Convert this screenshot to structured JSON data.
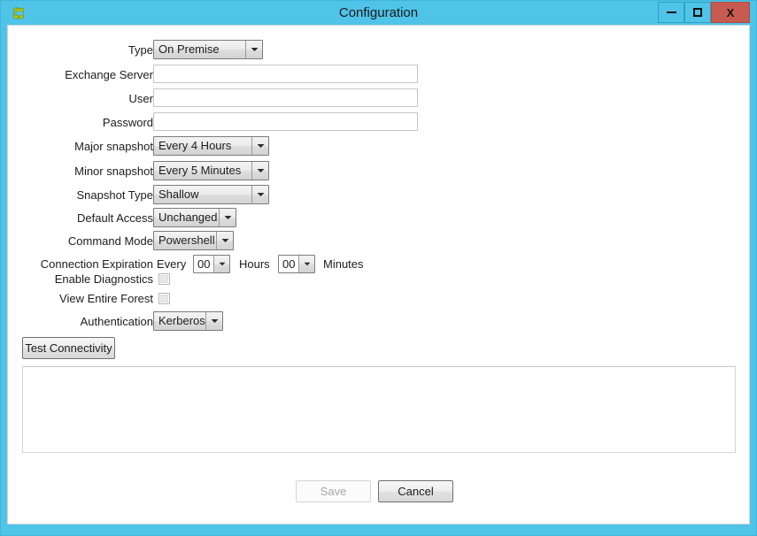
{
  "window": {
    "title": "Configuration",
    "app_icon": "puzzle-piece-icon",
    "accent_color": "#4fc3e8",
    "close_color": "#c75b51",
    "controls": {
      "minimize": "minimize-icon",
      "maximize": "maximize-icon",
      "close_label": "X"
    }
  },
  "form": {
    "rows": [
      {
        "label": "Type",
        "control": "combo",
        "value": "On Premise"
      },
      {
        "label": "Exchange Server",
        "control": "text",
        "value": "",
        "placeholder": ""
      },
      {
        "label": "User",
        "control": "text",
        "value": "",
        "placeholder": ""
      },
      {
        "label": "Password",
        "control": "text",
        "value": "",
        "placeholder": ""
      },
      {
        "label": "Major snapshot",
        "control": "combo",
        "value": "Every 4 Hours"
      },
      {
        "label": "Minor snapshot",
        "control": "combo",
        "value": "Every 5 Minutes"
      },
      {
        "label": "Snapshot Type",
        "control": "combo",
        "value": "Shallow"
      },
      {
        "label": "Default Access",
        "control": "combo",
        "value": "Unchanged"
      },
      {
        "label": "Command Mode",
        "control": "combo",
        "value": "Powershell"
      },
      {
        "label": "Connection Expiration",
        "control": "duration",
        "value": ""
      },
      {
        "label": "Enable Diagnostics",
        "control": "checkbox",
        "value": "unchecked"
      },
      {
        "label": "View Entire Forest",
        "control": "checkbox",
        "value": "unchecked"
      },
      {
        "label": "Authentication",
        "control": "combo",
        "value": "Kerberos"
      }
    ],
    "expiration": {
      "every_label": "Every",
      "hours_value": "00",
      "hours_label": "Hours",
      "minutes_value": "00",
      "minutes_label": "Minutes"
    }
  },
  "actions": {
    "test_connectivity": "Test Connectivity",
    "save": "Save",
    "cancel": "Cancel"
  },
  "log": {
    "content": ""
  }
}
